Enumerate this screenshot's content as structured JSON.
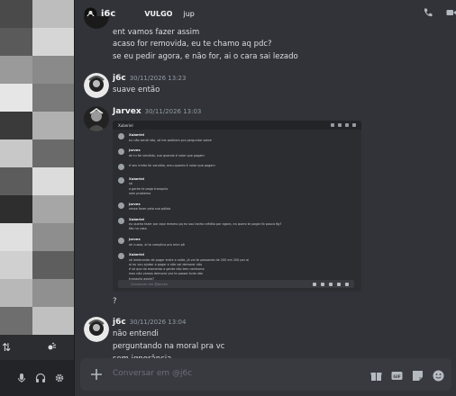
{
  "header": {
    "name": "j6c",
    "tag_label": "VULGO",
    "tag_value": "jup"
  },
  "messages": {
    "top_lines": [
      "ent vamos fazer assim",
      "acaso for removida, eu te chamo aq pdc?",
      "se eu pedir agora, e não for, ai o cara sai lezado"
    ],
    "m1": {
      "author": "j6c",
      "time": "30/11/2026 13:23",
      "text": "suave então"
    },
    "m2": {
      "author": "Jarvex",
      "time": "30/11/2026 13:03"
    },
    "m2b": {
      "text": "?"
    },
    "m3": {
      "author": "j6c",
      "time": "30/11/2026 13:04",
      "lines": [
        "não entendi",
        "perguntando na moral pra vc",
        "sem ignorância"
      ]
    }
  },
  "embed": {
    "header_name": "Xuberiel",
    "messages": [
      {
        "name": "Xuberiel",
        "lines": [
          "eu não sendi não, só me pediram pra perguntar sobre"
        ]
      },
      {
        "name": "Jarvex",
        "lines": [
          "ah tu foi vendido, sua quando é valor que pagam"
        ]
      },
      {
        "name": "",
        "lines": [
          "é seu irmão foi vendido, meu quanto é valor que pagam"
        ]
      },
      {
        "name": "Xuberiel",
        "lines": [
          "só",
          "a gente te pega tranquilo",
          "sem problema"
        ]
      },
      {
        "name": "Jarvex",
        "lines": [
          "nesse fazer pela sua pálida"
        ]
      },
      {
        "name": "Xuberiel",
        "lines": [
          "eu queria fazer por aqui mesmo pq eu sou tanho crédito por agora, eu quero te pagar tb pouco 6g?",
          "tão no caso"
        ]
      },
      {
        "name": "Jarvex",
        "lines": [
          "ah nussa, ai ta complica pra mim pô"
        ]
      },
      {
        "name": "Xuberiel",
        "lines": [
          "só lembrando de pagar entre a noite, já vai te passando de 200 em 200 por aí",
          "ai eu vou ajudar a pagar e não vai demorar não",
          "é só que do momento a gente não tem nenhuma",
          "mas não vamos demorar pra te passar tudo não",
          "tranquilo assim?"
        ]
      }
    ],
    "input_placeholder": "Conversar em @Jarvex"
  },
  "composer": {
    "placeholder": "Conversar em @j6c"
  },
  "colors": {
    "background": "#313338",
    "sidebar": "#2b2d31",
    "composer": "#383a40",
    "text": "#dbdee1"
  }
}
